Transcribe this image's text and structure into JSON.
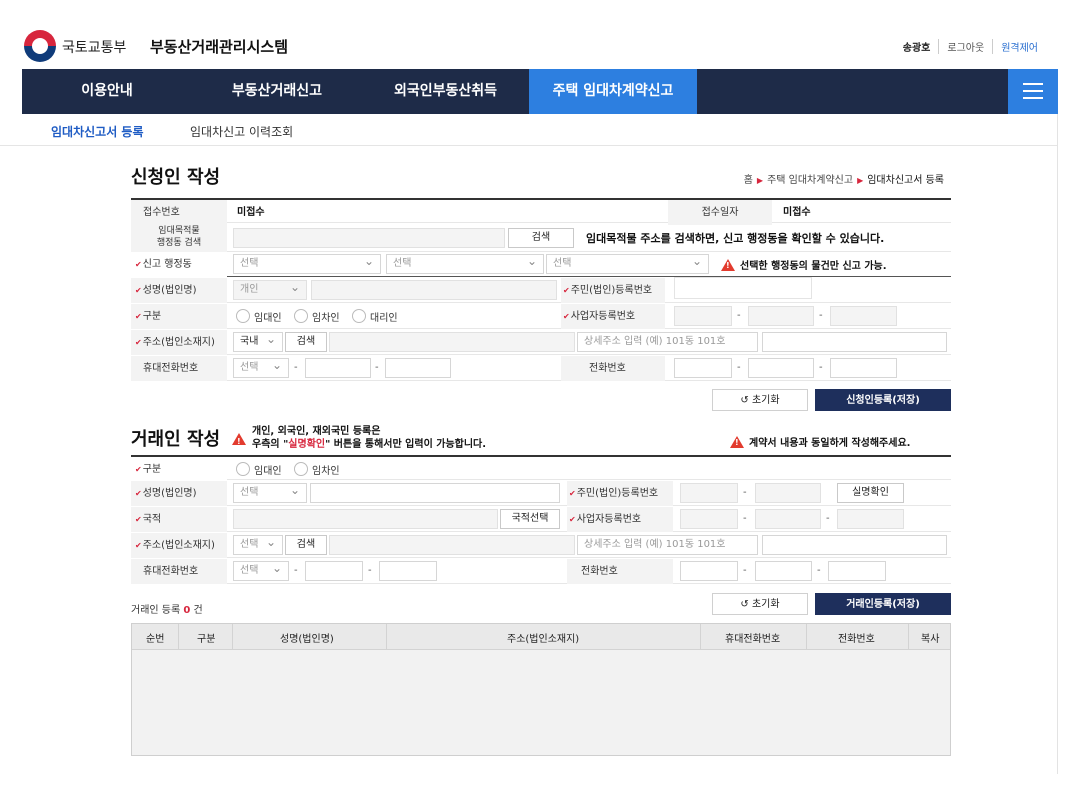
{
  "header": {
    "ministry": "국토교통부",
    "system_name": "부동산거래관리시스템",
    "util": [
      "송광호",
      "로그아웃",
      "원격제어"
    ]
  },
  "gnb": [
    "이용안내",
    "부동산거래신고",
    "외국인부동산취득",
    "주택 임대차계약신고"
  ],
  "subnav": [
    "임대차신고서 등록",
    "임대차신고 이력조회"
  ],
  "breadcrumb": [
    "홈",
    "주택 임대차계약신고",
    "임대차신고서 등록"
  ],
  "applicant": {
    "title": "신청인 작성",
    "receipt_no_label": "접수번호",
    "receipt_no_value": "미접수",
    "receipt_date_label": "접수일자",
    "receipt_date_value": "미접수",
    "search_label_1": "임대목적물",
    "search_label_2": "행정동 검색",
    "search_btn": "검색",
    "search_notice": "임대목적물 주소를 검색하면, 신고 행정동을 확인할 수 있습니다.",
    "admin_label": "신고 행정동",
    "select": "선택",
    "admin_notice": "선택한 행정동의 물건만 신고 가능.",
    "name_label": "성명(법인명)",
    "name_type": "개인",
    "rrn_label": "주민(법인)등록번호",
    "type_label": "구분",
    "types": [
      "임대인",
      "임차인",
      "대리인"
    ],
    "biz_label": "사업자등록번호",
    "addr_label": "주소(법인소재지)",
    "addr_domestic": "국내",
    "addr_search": "검색",
    "addr_detail_placeholder": "상세주소 입력 (예) 101동 101호",
    "mobile_label": "휴대전화번호",
    "tel_label": "전화번호",
    "reset_btn": "초기화",
    "save_btn": "신청인등록(저장)"
  },
  "trader": {
    "title": "거래인 작성",
    "notice_line1": "개인, 외국인, 재외국민 등록은",
    "notice_pre": "우측의 \"",
    "notice_red": "실명확인",
    "notice_post": "\" 버튼을 통해서만 입력이 가능합니다.",
    "right_notice": "계약서 내용과 동일하게 작성해주세요.",
    "type_label": "구분",
    "types": [
      "임대인",
      "임차인"
    ],
    "name_label": "성명(법인명)",
    "select": "선택",
    "rrn_label": "주민(법인)등록번호",
    "verify_btn": "실명확인",
    "nation_label": "국적",
    "nation_btn": "국적선택",
    "biz_label": "사업자등록번호",
    "addr_label": "주소(법인소재지)",
    "addr_search": "검색",
    "addr_detail_placeholder": "상세주소 입력 (예) 101동 101호",
    "mobile_label": "휴대전화번호",
    "tel_label": "전화번호",
    "count_prefix": "거래인 등록",
    "count_value": "0",
    "count_suffix": "건",
    "reset_btn": "초기화",
    "save_btn": "거래인등록(저장)"
  },
  "grid": {
    "columns": [
      "순번",
      "구분",
      "성명(법인명)",
      "주소(법인소재지)",
      "휴대전화번호",
      "전화번호",
      "복사"
    ]
  },
  "colors": {
    "navy": "#1e2b48",
    "accent": "#2d7fe0",
    "required": "#d7263d"
  }
}
